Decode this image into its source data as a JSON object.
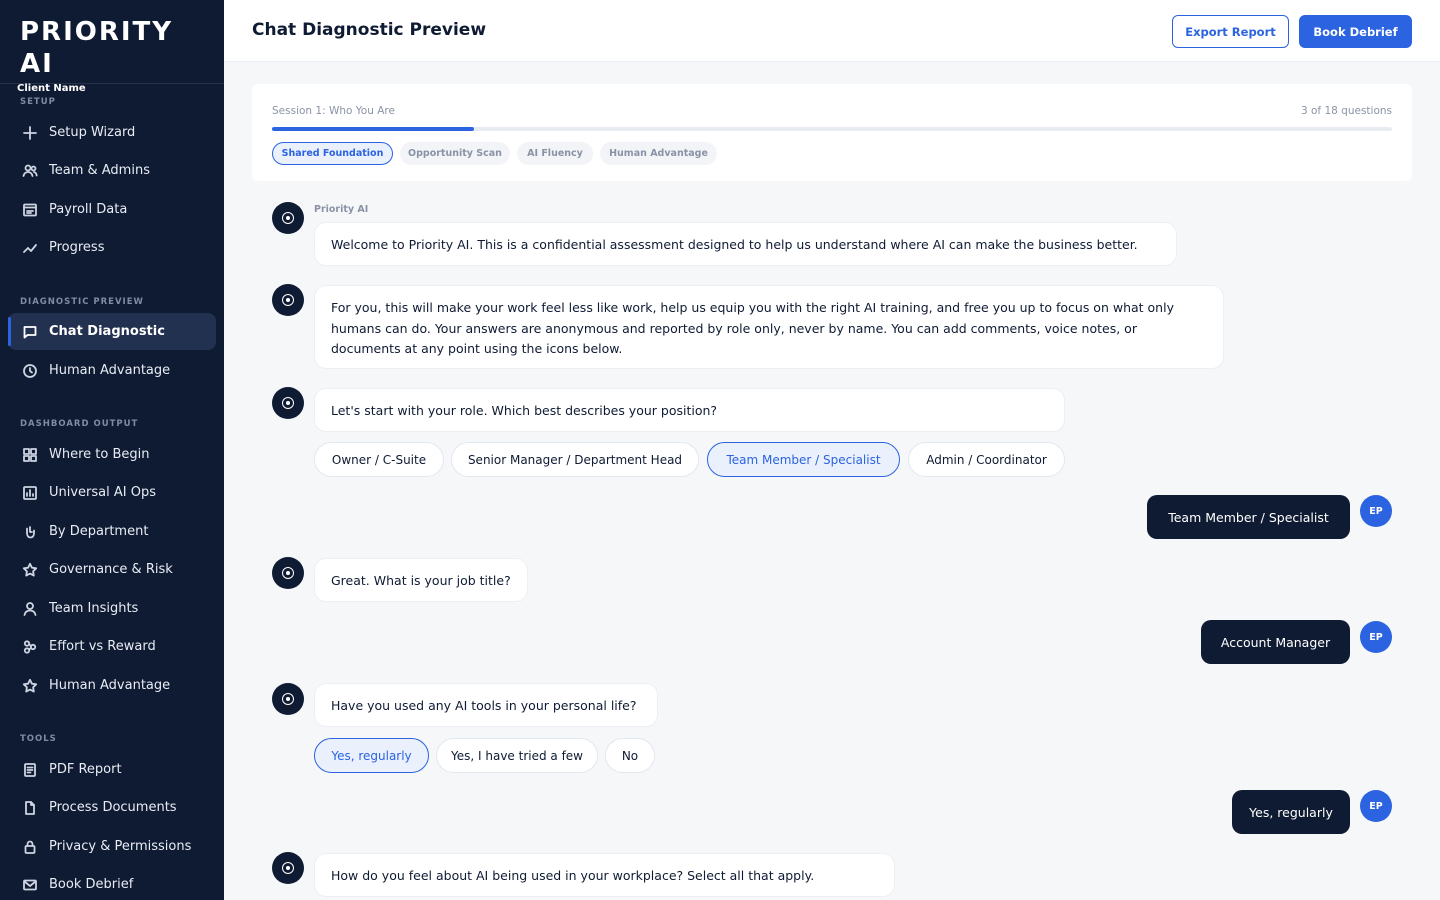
{
  "brand": {
    "title": "PRIORITY AI",
    "client": "Client Name"
  },
  "sidebar": {
    "sections": [
      {
        "label": "SETUP"
      },
      {
        "label": "DIAGNOSTIC PREVIEW"
      },
      {
        "label": "DASHBOARD OUTPUT"
      },
      {
        "label": "TOOLS"
      }
    ],
    "items": [
      {
        "label": "Setup Wizard",
        "icon": "plus-icon"
      },
      {
        "label": "Team & Admins",
        "icon": "users-icon"
      },
      {
        "label": "Payroll Data",
        "icon": "payroll-icon"
      },
      {
        "label": "Progress",
        "icon": "trend-icon"
      },
      {
        "label": "Chat Diagnostic",
        "icon": "chat-icon",
        "active": true
      },
      {
        "label": "Human Advantage",
        "icon": "clock-icon"
      },
      {
        "label": "Where to Begin",
        "icon": "grid-icon"
      },
      {
        "label": "Universal AI Ops",
        "icon": "chart-icon"
      },
      {
        "label": "By Department",
        "icon": "hand-icon"
      },
      {
        "label": "Governance & Risk",
        "icon": "star-icon"
      },
      {
        "label": "Team Insights",
        "icon": "user-icon"
      },
      {
        "label": "Effort vs Reward",
        "icon": "nodes-icon"
      },
      {
        "label": "Human Advantage",
        "icon": "star-icon"
      },
      {
        "label": "PDF Report",
        "icon": "document-icon"
      },
      {
        "label": "Process Documents",
        "icon": "file-icon"
      },
      {
        "label": "Privacy & Permissions",
        "icon": "lock-icon"
      },
      {
        "label": "Book Debrief",
        "icon": "mail-icon"
      }
    ]
  },
  "header": {
    "title": "Chat Diagnostic Preview",
    "export_label": "Export Report",
    "book_label": "Book Debrief"
  },
  "progress": {
    "session": "Session 1: Who You Are",
    "count": "3 of 18 questions",
    "fraction": 0.18,
    "tabs": [
      {
        "label": "Shared Foundation",
        "active": true
      },
      {
        "label": "Opportunity Scan"
      },
      {
        "label": "AI Fluency"
      },
      {
        "label": "Human Advantage"
      }
    ]
  },
  "chat": {
    "sender": "Priority AI",
    "messages": [
      {
        "text": "Welcome to Priority AI. This is a confidential assessment designed to help us understand where AI can make the business better."
      },
      {
        "text": "For you, this will make your work feel less like work, help us equip you with the right AI training, and free you up to focus on what only humans can do. Your answers are anonymous and reported by role only, never by name. You can add comments, voice notes, or documents at any point using the icons below."
      },
      {
        "text": "Let's start with your role. Which best describes your position?",
        "options": [
          "Owner / C-Suite",
          "Senior Manager / Department Head",
          "Team Member / Specialist",
          "Admin / Coordinator"
        ],
        "selected": "Team Member / Specialist"
      },
      {
        "text": "Great. What is your job title?"
      },
      {
        "text": "Have you used any AI tools in your personal life?",
        "options": [
          "Yes, regularly",
          "Yes, I have tried a few",
          "No"
        ],
        "selected": "Yes, regularly"
      },
      {
        "text": "How do you feel about AI being used in your workplace? Select all that apply."
      }
    ],
    "user_replies": [
      "Team Member / Specialist",
      "Account Manager",
      "Yes, regularly"
    ],
    "user_initials": "EP"
  },
  "colors": {
    "navy": "#0f1b33",
    "accent": "#2b63e0",
    "background": "#f6f7f9"
  }
}
